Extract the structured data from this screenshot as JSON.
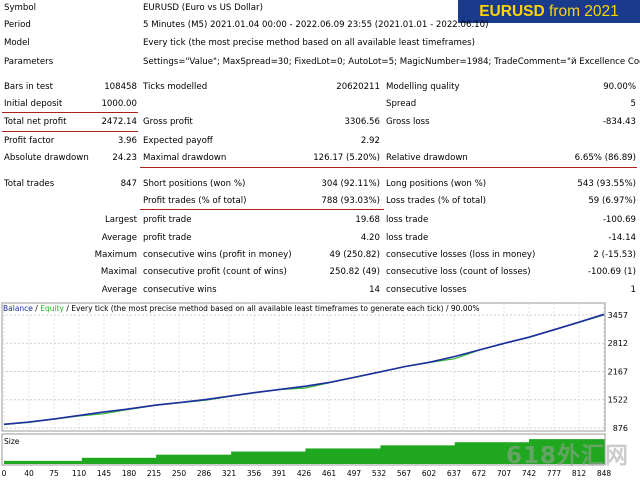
{
  "banner": {
    "symbol": "EURUSD",
    "rest": " from 2021"
  },
  "header": [
    {
      "label": "Symbol",
      "value": "EURUSD (Euro vs US Dollar)"
    },
    {
      "label": "Period",
      "value": "5 Minutes (M5) 2021.01.04 00:00 - 2022.06.09 23:55 (2021.01.01 - 2022.06.10)"
    },
    {
      "label": "Model",
      "value": "Every tick (the most precise method based on all available least timeframes)"
    },
    {
      "label": "Parameters",
      "value": "Settings=\"Value\"; MaxSpread=30; FixedLot=0; AutoLot=5; MagicNumber=1984; TradeComment=\"й Excellence Code EURUSD \";"
    }
  ],
  "stats": {
    "bars_in_test": {
      "label": "Bars in test",
      "value": "108458"
    },
    "ticks_modelled": {
      "label": "Ticks modelled",
      "value": "20620211"
    },
    "modelling_quality": {
      "label": "Modelling quality",
      "value": "90.00%"
    },
    "initial_deposit": {
      "label": "Initial deposit",
      "value": "1000.00"
    },
    "spread": {
      "label": "Spread",
      "value": "5"
    },
    "total_net_profit": {
      "label": "Total net profit",
      "value": "2472.14"
    },
    "gross_profit": {
      "label": "Gross profit",
      "value": "3306.56"
    },
    "gross_loss": {
      "label": "Gross loss",
      "value": "-834.43"
    },
    "profit_factor": {
      "label": "Profit factor",
      "value": "3.96"
    },
    "expected_payoff": {
      "label": "Expected payoff",
      "value": "2.92"
    },
    "absolute_drawdown": {
      "label": "Absolute drawdown",
      "value": "24.23"
    },
    "maximal_drawdown": {
      "label": "Maximal drawdown",
      "value": "126.17 (5.20%)"
    },
    "relative_drawdown": {
      "label": "Relative drawdown",
      "value": "6.65% (86.89)"
    },
    "total_trades": {
      "label": "Total trades",
      "value": "847"
    },
    "short_positions": {
      "label": "Short positions (won %)",
      "value": "304 (92.11%)"
    },
    "long_positions": {
      "label": "Long positions (won %)",
      "value": "543 (93.55%)"
    },
    "profit_trades": {
      "label": "Profit trades (% of total)",
      "value": "788 (93.03%)"
    },
    "loss_trades": {
      "label": "Loss trades (% of total)",
      "value": "59 (6.97%)"
    }
  },
  "detail_rows": [
    {
      "prefix": "Largest",
      "l1": "profit trade",
      "v1": "19.68",
      "l2": "loss trade",
      "v2": "-100.69"
    },
    {
      "prefix": "Average",
      "l1": "profit trade",
      "v1": "4.20",
      "l2": "loss trade",
      "v2": "-14.14"
    },
    {
      "prefix": "Maximum",
      "l1": "consecutive wins (profit in money)",
      "v1": "49 (250.82)",
      "l2": "consecutive losses (loss in money)",
      "v2": "2 (-15.53)"
    },
    {
      "prefix": "Maximal",
      "l1": "consecutive profit (count of wins)",
      "v1": "250.82 (49)",
      "l2": "consecutive loss (count of losses)",
      "v2": "-100.69 (1)"
    },
    {
      "prefix": "Average",
      "l1": "consecutive wins",
      "v1": "14",
      "l2": "consecutive losses",
      "v2": "1"
    }
  ],
  "legend": {
    "balance": "Balance",
    "sep": " / ",
    "equity": "Equity",
    "rest": " / Every tick (the most precise method based on all available least timeframes to generate each tick) / 90.00%"
  },
  "size_label": "Size",
  "watermark": "618外汇网",
  "colors": {
    "balance": "#1c2ea0",
    "equity": "#2fb52f",
    "size": "#1fa81f",
    "banner_bg": "#1a3b8c",
    "banner_text": "#ffd400",
    "accent_line": "#b0201a"
  },
  "chart_data": {
    "type": "line",
    "series": [
      {
        "name": "Balance",
        "x": [
          0,
          35,
          70,
          105,
          140,
          180,
          215,
          250,
          286,
          321,
          356,
          391,
          426,
          461,
          497,
          532,
          567,
          602,
          637,
          672,
          707,
          742,
          777,
          812,
          848
        ],
        "values": [
          960,
          1010,
          1080,
          1160,
          1240,
          1320,
          1400,
          1460,
          1530,
          1610,
          1690,
          1760,
          1830,
          1920,
          2040,
          2160,
          2280,
          2380,
          2510,
          2660,
          2810,
          2950,
          3120,
          3290,
          3472
        ]
      },
      {
        "name": "Equity",
        "x": [
          0,
          35,
          70,
          105,
          140,
          180,
          215,
          250,
          286,
          321,
          356,
          391,
          426,
          461,
          497,
          532,
          567,
          602,
          637,
          672,
          707,
          742,
          777,
          812,
          848
        ],
        "values": [
          955,
          1005,
          1075,
          1150,
          1200,
          1310,
          1395,
          1455,
          1510,
          1605,
          1685,
          1755,
          1790,
          1915,
          2035,
          2155,
          2275,
          2375,
          2460,
          2655,
          2805,
          2945,
          3115,
          3285,
          3460
        ]
      }
    ],
    "ylim": [
      876,
      3457
    ],
    "y_ticks": [
      "3457",
      "2812",
      "2167",
      "1522",
      "876"
    ],
    "x_ticks": [
      "0",
      "40",
      "75",
      "110",
      "145",
      "180",
      "215",
      "250",
      "286",
      "321",
      "356",
      "391",
      "426",
      "461",
      "497",
      "532",
      "567",
      "602",
      "637",
      "672",
      "707",
      "742",
      "777",
      "812",
      "848"
    ],
    "size_series": {
      "name": "Size",
      "x": [
        0,
        110,
        215,
        321,
        426,
        532,
        637,
        742,
        848
      ],
      "values": [
        1,
        2,
        3,
        4,
        5,
        6,
        7,
        8,
        9
      ]
    },
    "grid": true
  }
}
